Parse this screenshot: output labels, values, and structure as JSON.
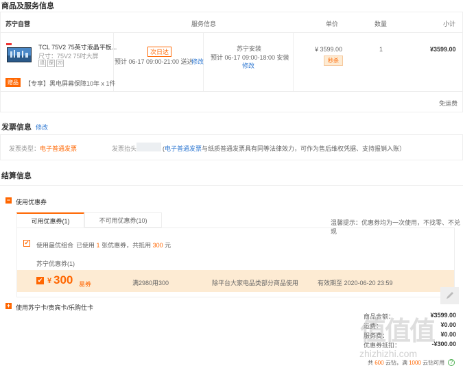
{
  "colors": {
    "accent": "#ff6600",
    "link": "#2f78d2",
    "coupon_bg": "#fdebd3",
    "border": "#eeeeee"
  },
  "goods_section": {
    "title": "商品及服务信息",
    "store_name": "苏宁自营",
    "headers": {
      "service": "服务信息",
      "price": "单价",
      "quantity": "数量",
      "subtotal": "小计"
    },
    "product": {
      "name": "TCL 75V2 75英寸液晶平板...",
      "spec": "尺寸：75V2 75吋大屏",
      "tags": [
        "退",
        "保",
        "20"
      ],
      "gift_badge": "赠品",
      "gift_text": "【专享】黑电屏幕保障10年 x 1件"
    },
    "delivery": {
      "badge": "次日达",
      "estimate": "预计 06-17 09:00-21:00 送达",
      "modify": "修改"
    },
    "install": {
      "title": "苏宁安装",
      "estimate": "预计 06-17 09:00-18:00 安装",
      "modify": "修改"
    },
    "price": "¥ 3599.00",
    "price_badge": "秒杀",
    "quantity": "1",
    "subtotal": "¥3599.00",
    "freight": "免运费"
  },
  "invoice_section": {
    "title": "发票信息",
    "modify": "修改",
    "type_label": "发票类型：",
    "type_value": "电子普通发票",
    "header_label": "发票抬头：",
    "note_link": "电子普通发票",
    "note_text": "与纸质普通发票具有同等法律效力，可作为售后维权凭据、支持报销入账）",
    "note_open": "("
  },
  "settle_section": {
    "title": "结算信息",
    "coupon_toggle": "使用优惠券",
    "tabs": [
      "可用优惠券(1)",
      "不可用优惠券(10)"
    ],
    "tip": "温馨提示：优惠券均为一次使用，不找零、不兑现",
    "best_combo_label": "使用最优组合",
    "best_combo_pre": "已使用",
    "best_combo_count": "1",
    "best_combo_mid": "张优惠券，共抵用",
    "best_combo_amount": "300",
    "best_combo_unit": "元",
    "group_title": "苏宁优惠券(1)",
    "coupon": {
      "symbol": "¥",
      "amount": "300",
      "type": "易券",
      "rule": "满2980用300",
      "scope": "除平台大家电品类部分商品使用",
      "validity": "有效期至 2020-06-20 23:59"
    },
    "card_toggle": "使用苏宁卡/贵宾卡/乐购仕卡"
  },
  "summary": {
    "rows": [
      {
        "label": "商品金额：",
        "value": "¥3599.00"
      },
      {
        "label": "运费：",
        "value": "¥0.00"
      },
      {
        "label": "服务费：",
        "value": "¥0.00"
      },
      {
        "label": "优惠券抵扣：",
        "value": "-¥300.00"
      }
    ],
    "cloud_pre": "共",
    "cloud_count": "600",
    "cloud_mid": "云钻，满",
    "cloud_limit": "1000",
    "cloud_post": "云钻可用"
  },
  "watermark": {
    "text": "zhizhizhi.com",
    "logo": "值值值"
  },
  "edit_icon": "pencil-icon"
}
